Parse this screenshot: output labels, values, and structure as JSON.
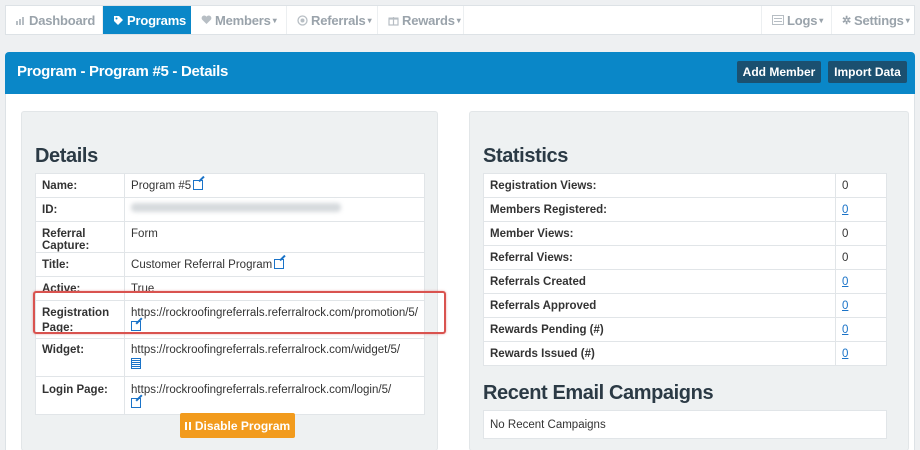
{
  "nav": {
    "items": [
      {
        "label": "Dashboard",
        "icon": "bar-chart-icon"
      },
      {
        "label": "Programs",
        "icon": "tag-icon",
        "active": true
      },
      {
        "label": "Members",
        "icon": "heart-icon",
        "caret": true
      },
      {
        "label": "Referrals",
        "icon": "target-icon",
        "caret": true
      },
      {
        "label": "Rewards",
        "icon": "gift-icon",
        "caret": true
      }
    ],
    "right_items": [
      {
        "label": "Logs",
        "icon": "list-icon",
        "caret": true
      },
      {
        "label": "Settings",
        "icon": "gear-icon",
        "caret": true
      }
    ]
  },
  "header": {
    "title": "Program - Program #5 - Details",
    "add_member_label": "Add Member",
    "import_data_label": "Import Data",
    "accent_color": "#0a87c8"
  },
  "details": {
    "title": "Details",
    "rows": {
      "name": {
        "label": "Name:",
        "value": "Program #5"
      },
      "id": {
        "label": "ID:",
        "value": ""
      },
      "referral_capture": {
        "label": "Referral Capture:",
        "value": "Form"
      },
      "title": {
        "label": "Title:",
        "value": "Customer Referral Program"
      },
      "active": {
        "label": "Active:",
        "value": "True"
      },
      "registration_page": {
        "label_line1": "Registration",
        "label_line2": "Page:",
        "value": "https://rockroofingreferrals.referralrock.com/promotion/5/"
      },
      "widget": {
        "label": "Widget:",
        "value": "https://rockroofingreferrals.referralrock.com/widget/5/"
      },
      "login_page": {
        "label": "Login Page:",
        "value": "https://rockroofingreferrals.referralrock.com/login/5/"
      }
    },
    "disable_button_label": "Disable Program",
    "disable_button_color": "#f29b1d"
  },
  "statistics": {
    "title": "Statistics",
    "rows": [
      {
        "label": "Registration Views:",
        "value": "0",
        "link": false
      },
      {
        "label": "Members Registered:",
        "value": "0",
        "link": true
      },
      {
        "label": "Member Views:",
        "value": "0",
        "link": false
      },
      {
        "label": "Referral Views:",
        "value": "0",
        "link": false
      },
      {
        "label": "Referrals Created",
        "value": "0",
        "link": true
      },
      {
        "label": "Referrals Approved",
        "value": "0",
        "link": true
      },
      {
        "label": "Rewards Pending (#)",
        "value": "0",
        "link": true
      },
      {
        "label": "Rewards Issued (#)",
        "value": "0",
        "link": true
      }
    ]
  },
  "campaigns": {
    "title": "Recent Email Campaigns",
    "empty_text": "No Recent Campaigns"
  },
  "highlight_color": "#d9534f"
}
